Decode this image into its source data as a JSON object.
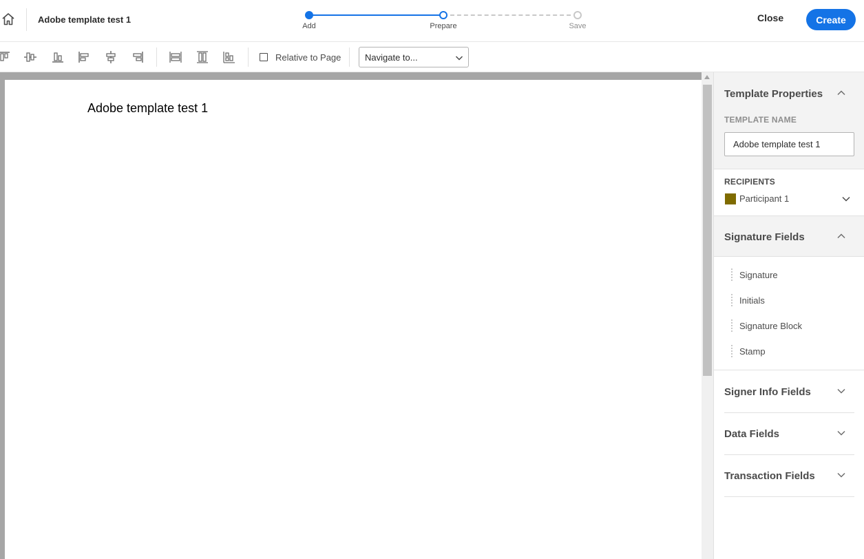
{
  "header": {
    "doc_title": "Adobe template test 1",
    "steps": [
      {
        "label": "Add"
      },
      {
        "label": "Prepare"
      },
      {
        "label": "Save"
      }
    ],
    "close_label": "Close",
    "create_label": "Create"
  },
  "toolbar": {
    "relative_label": "Relative to Page",
    "navigate_value": "Navigate to..."
  },
  "document": {
    "page_text": "Adobe template test 1"
  },
  "panel": {
    "template_properties": {
      "title": "Template Properties",
      "name_label": "TEMPLATE NAME",
      "name_value": "Adobe template test 1"
    },
    "recipients": {
      "label": "RECIPIENTS",
      "participant": "Participant 1",
      "participant_color": "#7f6b00"
    },
    "signature_fields": {
      "title": "Signature Fields",
      "items": [
        "Signature",
        "Initials",
        "Signature Block",
        "Stamp"
      ]
    },
    "signer_info": {
      "title": "Signer Info Fields"
    },
    "data_fields": {
      "title": "Data Fields"
    },
    "transaction_fields": {
      "title": "Transaction Fields"
    }
  },
  "colors": {
    "accent": "#1473e6",
    "panel_header_bg": "#f3f3f3",
    "canvas_bg": "#a6a6a6"
  }
}
